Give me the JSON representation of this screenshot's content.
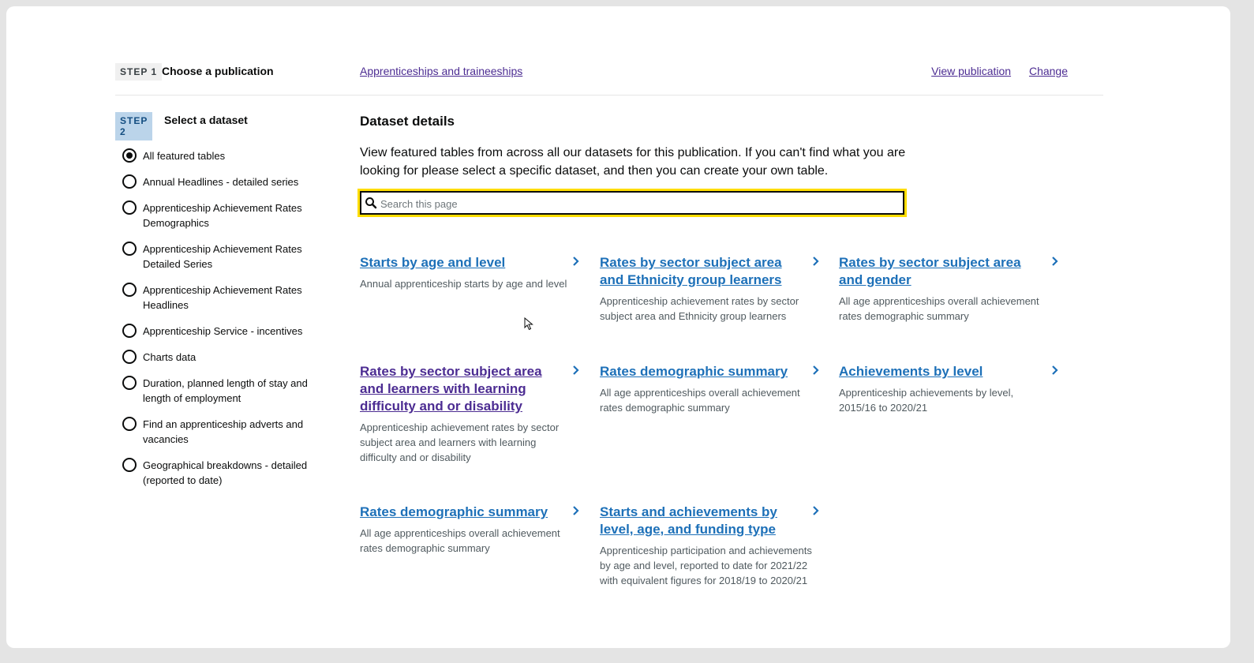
{
  "step1": {
    "tag": "STEP 1",
    "title": "Choose a publication",
    "publication_link": "Apprenticeships and traineeships",
    "view_publication": "View publication",
    "change": "Change"
  },
  "step2": {
    "tag": "STEP 2",
    "title": "Select a dataset",
    "options": [
      {
        "label": "All featured tables",
        "checked": true
      },
      {
        "label": "Annual Headlines - detailed series",
        "checked": false
      },
      {
        "label": "Apprenticeship Achievement Rates Demographics",
        "checked": false
      },
      {
        "label": "Apprenticeship Achievement Rates Detailed Series",
        "checked": false
      },
      {
        "label": "Apprenticeship Achievement Rates Headlines",
        "checked": false
      },
      {
        "label": "Apprenticeship Service - incentives",
        "checked": false
      },
      {
        "label": "Charts data",
        "checked": false
      },
      {
        "label": "Duration, planned length of stay and length of employment",
        "checked": false
      },
      {
        "label": "Find an apprenticeship adverts and vacancies",
        "checked": false
      },
      {
        "label": "Geographical breakdowns - detailed (reported to date)",
        "checked": false
      }
    ]
  },
  "details": {
    "title": "Dataset details",
    "intro": "View featured tables from across all our datasets for this publication. If you can't find what you are looking for please select a specific dataset, and then you can create your own table.",
    "search_placeholder": "Search this page",
    "search_value": ""
  },
  "tables": [
    {
      "title": "Starts by age and level",
      "description": "Annual apprenticeship starts by age and level"
    },
    {
      "title": "Rates by sector subject area and Ethnicity group learners",
      "description": "Apprenticeship achievement rates by sector subject area and Ethnicity group learners"
    },
    {
      "title": "Rates by sector subject area and gender",
      "description": "All age apprenticeships overall achievement rates demographic summary"
    },
    {
      "title": "Rates by sector subject area and learners with learning difficulty and or disability",
      "description": "Apprenticeship achievement rates by sector subject area and learners with learning difficulty and or disability"
    },
    {
      "title": "Rates demographic summary",
      "description": "All age apprenticeships overall achievement rates demographic summary"
    },
    {
      "title": "Achievements by level",
      "description": "Apprenticeship achievements by level, 2015/16 to 2020/21"
    },
    {
      "title": "Rates demographic summary",
      "description": "All age apprenticeships overall achievement rates demographic summary"
    },
    {
      "title": "Starts and achievements by level, age, and funding type",
      "description": "Apprenticeship participation and achievements by age and level, reported to date for 2021/22 with equivalent figures for 2018/19 to 2020/21"
    }
  ],
  "colors": {
    "link": "#1d70b8",
    "visited_link": "#4c2c92",
    "focus": "#ffdd00",
    "step2_tag_bg": "#bbd4ea"
  },
  "icons": {
    "search": "search-icon",
    "chevron": "chevron-right-icon",
    "cursor": "mouse-pointer-icon"
  }
}
